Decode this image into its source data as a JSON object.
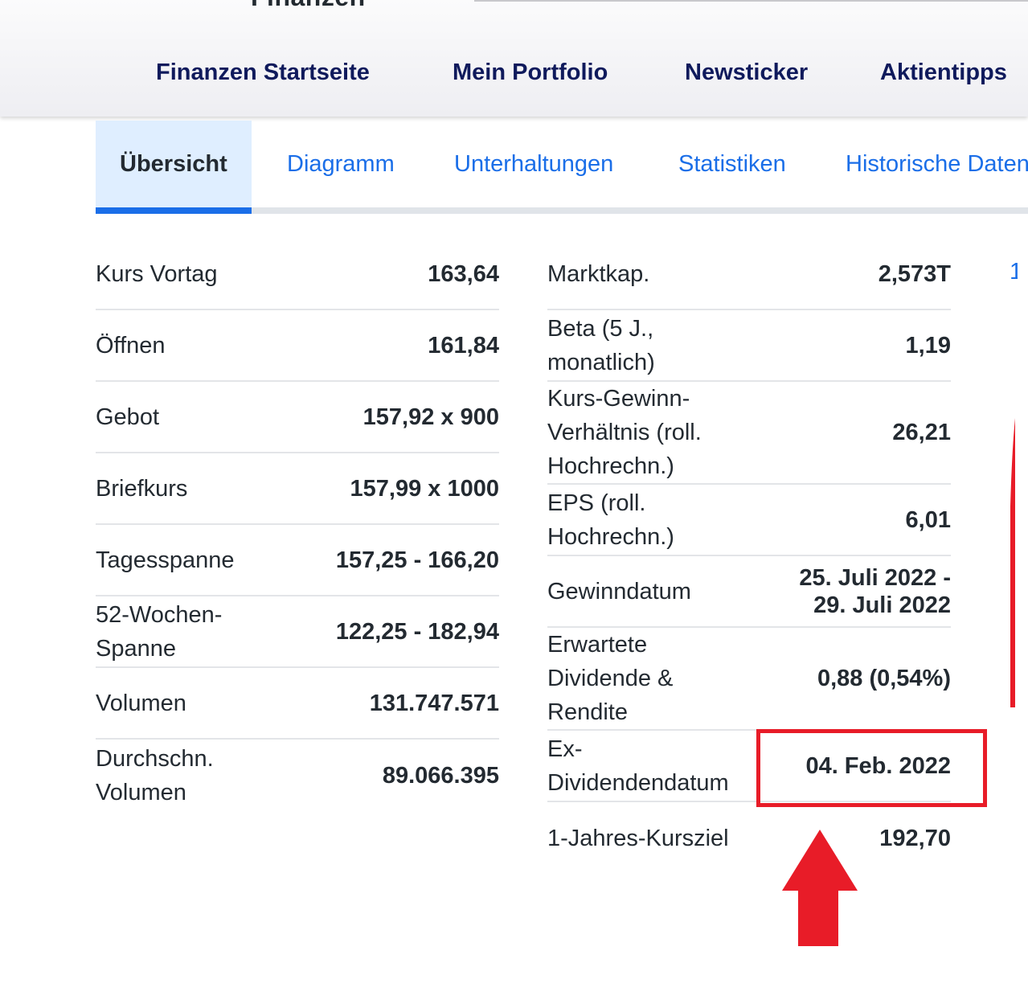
{
  "header": {
    "logo_text": "Finanzen",
    "nav": [
      "Finanzen Startseite",
      "Mein Portfolio",
      "Newsticker",
      "Aktientipps"
    ]
  },
  "tabs": [
    "Übersicht",
    "Diagramm",
    "Unterhaltungen",
    "Statistiken",
    "Historische Daten"
  ],
  "left_table": [
    {
      "label": "Kurs Vortag",
      "value": "163,64"
    },
    {
      "label": "Öffnen",
      "value": "161,84"
    },
    {
      "label": "Gebot",
      "value": "157,92 x 900"
    },
    {
      "label": "Briefkurs",
      "value": "157,99 x 1000"
    },
    {
      "label": "Tagesspanne",
      "value": "157,25 - 166,20"
    },
    {
      "label": "52-Wochen-Spanne",
      "value": "122,25 - 182,94"
    },
    {
      "label": "Volumen",
      "value": "131.747.571"
    },
    {
      "label": "Durchschn. Volumen",
      "value": "89.066.395"
    }
  ],
  "right_table": [
    {
      "label": "Marktkap.",
      "value": "2,573T"
    },
    {
      "label": "Beta (5 J., monatlich)",
      "value": "1,19"
    },
    {
      "label": "Kurs-Gewinn-Verhältnis (roll. Hochrechn.)",
      "value": "26,21"
    },
    {
      "label": "EPS (roll. Hochrechn.)",
      "value": "6,01"
    },
    {
      "label": "Gewinndatum",
      "value": "25. Juli 2022 - 29. Juli 2022"
    },
    {
      "label": "Erwartete Dividende & Rendite",
      "value": "0,88 (0,54%)"
    },
    {
      "label": "Ex-Dividendendatum",
      "value": "04. Feb. 2022"
    },
    {
      "label": "1-Jahres-Kursziel",
      "value": "192,70"
    }
  ],
  "right_edge_text": "1",
  "colors": {
    "accent": "#1a6ee8",
    "nav_text": "#0f1a5c",
    "active_tab_bg": "#dfeeff",
    "annotation_red": "#e81c28"
  }
}
